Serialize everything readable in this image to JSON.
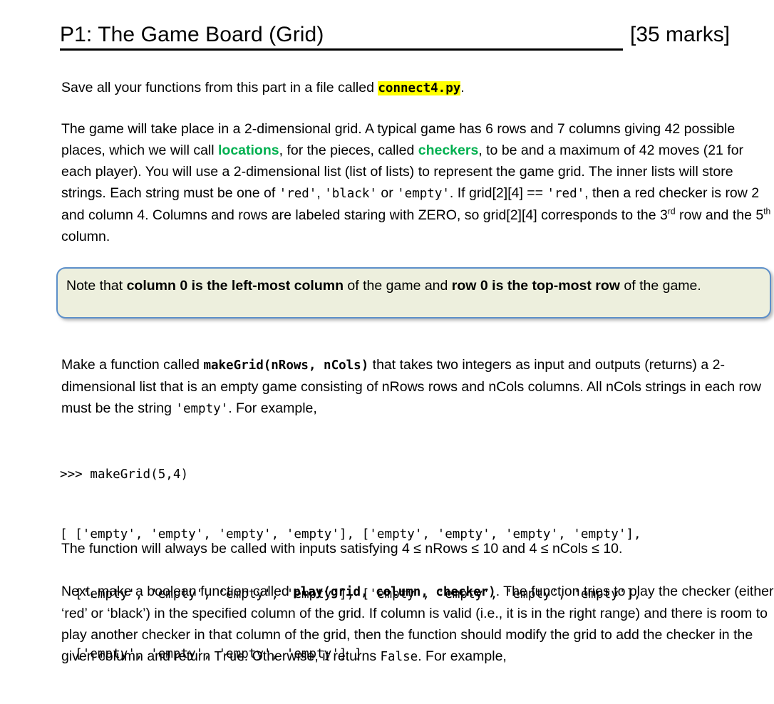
{
  "heading": {
    "title": "P1: The Game Board (Grid)",
    "marks": "[35 marks]"
  },
  "save_paragraph": {
    "before": "Save all your functions from this part in a file called ",
    "filename": "connect4.py",
    "after": "."
  },
  "intro_paragraph": {
    "seg1": "The game will take place in a 2-dimensional grid. A typical game has 6 rows and 7 columns giving 42 possible places, which we will call ",
    "term1": "locations",
    "seg2": ", for the pieces, called ",
    "term2": "checkers",
    "seg3": ", to be and a maximum of 42 moves (21 for each player). You will use a 2-dimensional list (list of lists) to represent the game grid. The inner lists will store strings. Each string must be one of ",
    "code1": "'red'",
    "seg4": ", ",
    "code2": "'black'",
    "seg5": " or ",
    "code3": "'empty'",
    "seg6": ". If grid[2][4] == ",
    "code4": "'red'",
    "seg7": ", then a red checker is row 2 and column 4. Columns and rows are labeled staring with ZERO, so grid[2][4] corresponds to the 3",
    "sup1": "rd",
    "seg8": " row and the 5",
    "sup2": "th",
    "seg9": " column."
  },
  "note_box": {
    "seg1": "Note that ",
    "bold1": "column 0 is the left-most column",
    "seg2": " of the game and ",
    "bold2": "row 0 is the top-most row",
    "seg3": " of the game."
  },
  "make_paragraph": {
    "seg1": "Make a function called ",
    "code1": "makeGrid(nRows, nCols)",
    "seg2": " that takes two integers as input and outputs (returns) a 2-dimensional list that is an empty game consisting of nRows rows and nCols columns. All nCols strings in each row must be the string ",
    "code2": "'empty'",
    "seg3": ". For example,"
  },
  "code_example_1": {
    "lines": [
      ">>> makeGrid(5,4)",
      "[ ['empty', 'empty', 'empty', 'empty'], ['empty', 'empty', 'empty', 'empty'],",
      "  ['empty', 'empty', 'empty', 'empty'], ['empty', 'empty', 'empty', 'empty'],",
      "  ['empty', 'empty', 'empty', 'empty'] ]"
    ]
  },
  "range_paragraph": {
    "text": "The function will always be called with inputs satisfying 4 ≤ nRows ≤ 10 and 4 ≤ nCols ≤ 10."
  },
  "play_paragraph": {
    "seg1": "Next, make a boolean function called ",
    "code1": "play(grid, column, checker)",
    "seg2": ". The function tries to play the checker (either ‘red’ or ‘black’) in the specified column of the grid. If column is valid (i.e., it is in the right range) and there is room to play another checker in that column of the grid, then the function should modify the grid to add the checker in the given column and return ",
    "code2": "True",
    "seg3": ". Otherwise, it returns ",
    "code3": "False",
    "seg4": ". For example,"
  },
  "colors": {
    "highlight": "#ffff00",
    "term_green": "#00b050",
    "note_border": "#5c8fc9",
    "note_background": "#edefdd",
    "text": "#000000"
  }
}
